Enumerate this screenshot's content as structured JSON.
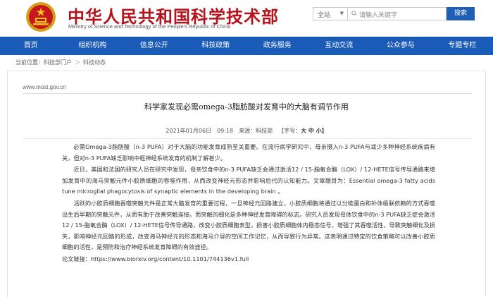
{
  "header": {
    "title_cn": "中华人民共和国科学技术部",
    "title_en": "Ministry of Science and Technology of the People's Republic of China",
    "search": {
      "scope": "全站",
      "placeholder": "请输入关键字",
      "button": "搜索"
    }
  },
  "nav": {
    "items": [
      "首页",
      "组织机构",
      "信息公开",
      "科技政策",
      "政务服务",
      "互动交流",
      "公众参与",
      "专题专栏"
    ]
  },
  "breadcrumb": {
    "label": "当前位置：",
    "items": [
      "科技部门户",
      "科技动态"
    ],
    "separator": "＞"
  },
  "site_url": "www.most.gov.cn",
  "article": {
    "title": "科学家发现必需omega-3脂肪酸对发育中的大脑有调节作用",
    "meta": {
      "date": "2021年01月06日",
      "time": "09:18",
      "source": "来源：科技部",
      "font_size_label": "【字号：",
      "font_size_options": "大 中 小】"
    },
    "paragraphs": [
      "必需Omega-3脂肪酸（n-3 PUFA）对于大脑的功能发育成熟至关重要。在流行病学研究中，母亲摄入n-3 PUFA与减少多种神经系统疾病有关，但对n-3 PUFA缺乏影响中枢神经系统发育的机制了解甚少。",
      "近日，美国和法国的研究人员在研究中发现，母亲饮食中的n-3 PUFA缺乏会通过激活12 / 15-脂氧合酶（LOX）/ 12-HETE信号传导通路来增加发育中的海马突触元件小胶质细胞的吞噬作用，从而改变神经元形态并影响后代的认知能力。文章题目为：Essential omega-3 fatty acids tune microglial phagocytosis of synaptic elements in the developing brain 。",
      "活跃的小胶质细胞吞噬突触元件是正常大脑发育的重要过程，一旦神经元回路建立，小胶质细胞将通过以分链蛋白和补体级联依赖的方式吞噬出生后早期的突触元件，从而有助于改善突触连接。而突触的细化是多种神经发育障碍的标志。研究人员发现母体饮食中的n-3 PUFA缺乏症会激活12 / 15-脂氧合酶（LOX）/ 12-HETE信号传导通路，改变小胶质细胞表型，损害小胶质细胞体内稳态信号，增强了其吞噬活性，导致突触细化及损失，影响神经元回路的形成，改变海马神经元的形态和海马介导的空间工作记忆，从而导致行为异常。这表明通过特定的饮食策略可以改善小胶质细胞的活性，是预防和治疗神经系统发育障碍的有效途径。"
    ],
    "link_label": "论文链接：",
    "link_url": "https://www.biorxiv.org/content/10.1101/744136v1.full"
  },
  "colors": {
    "brand_red": "#b5121b",
    "nav_blue": "#1b5bb8",
    "search_button": "#1f5fb5"
  }
}
